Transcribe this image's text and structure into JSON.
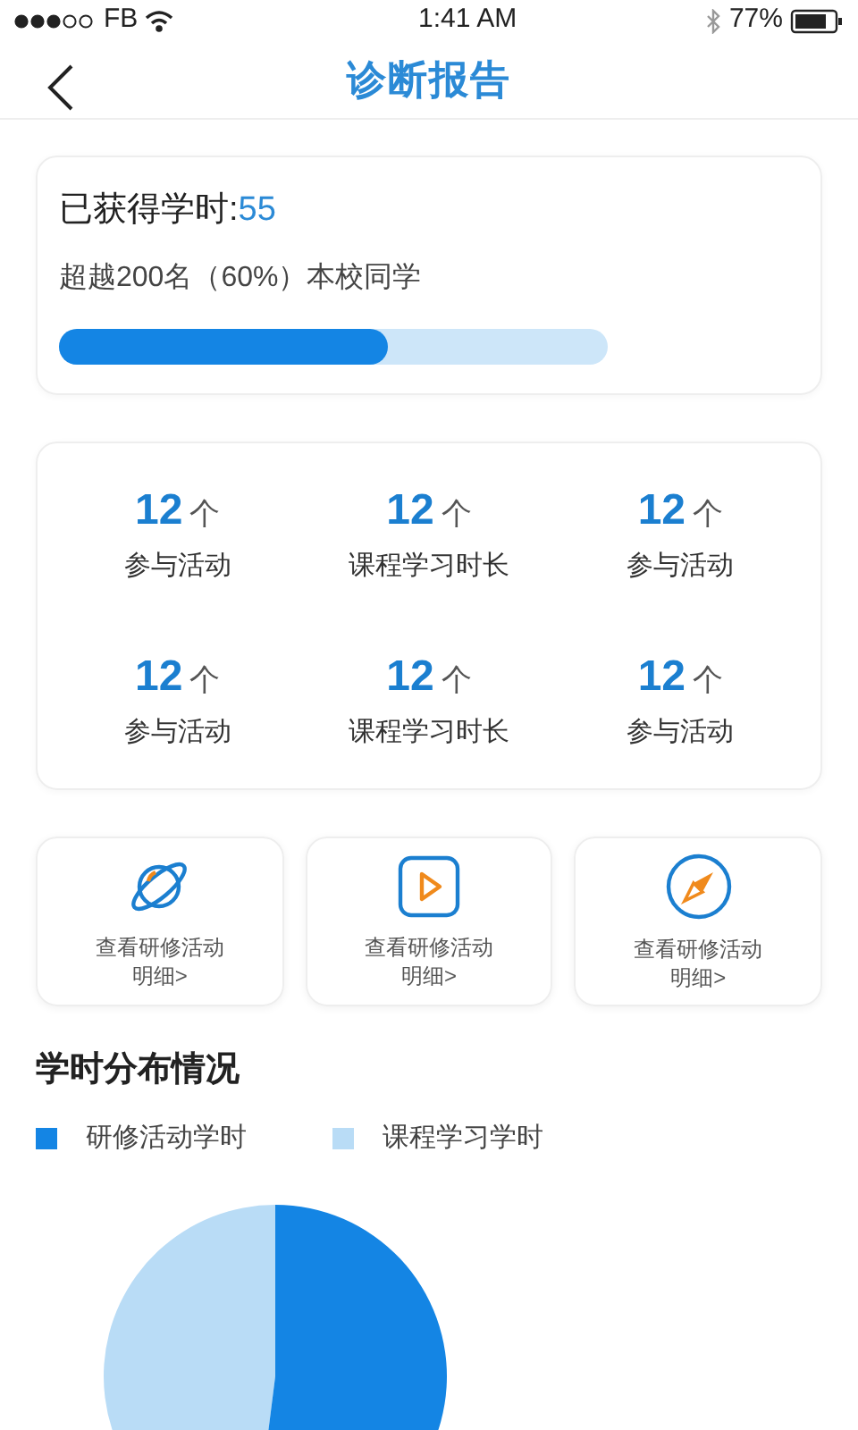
{
  "status_bar": {
    "carrier": "FB",
    "time": "1:41 AM",
    "battery": "77%"
  },
  "nav": {
    "title": "诊断报告"
  },
  "summary": {
    "label": "已获得学时:",
    "value": "55",
    "subtitle": "超越200名（60%）本校同学",
    "level": 0.6
  },
  "stats": [
    {
      "value": "12",
      "unit": "个",
      "label": "参与活动"
    },
    {
      "value": "12",
      "unit": "个",
      "label": "课程学习时长"
    },
    {
      "value": "12",
      "unit": "个",
      "label": "参与活动"
    },
    {
      "value": "12",
      "unit": "个",
      "label": "参与活动"
    },
    {
      "value": "12",
      "unit": "个",
      "label": "课程学习时长"
    },
    {
      "value": "12",
      "unit": "个",
      "label": "参与活动"
    }
  ],
  "tiles": [
    {
      "kind": "planet",
      "line1": "查看研修活动",
      "line2": "明细>"
    },
    {
      "kind": "play",
      "line1": "查看研修活动",
      "line2": "明细>"
    },
    {
      "kind": "compass",
      "line1": "查看研修活动",
      "line2": "明细>"
    }
  ],
  "distribution": {
    "title": "学时分布情况",
    "legend": [
      {
        "label": "研修活动学时",
        "color": "#1485e4"
      },
      {
        "label": "课程学习学时",
        "color": "#b9dcf6"
      }
    ]
  }
}
